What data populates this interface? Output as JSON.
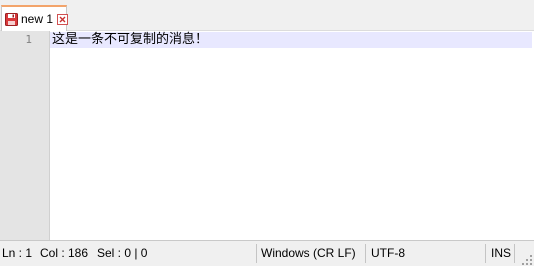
{
  "tabs": [
    {
      "label": "new 1",
      "icon": "save-icon",
      "close_icon": "close-icon",
      "accent": "#f3a46b"
    }
  ],
  "editor": {
    "line_numbers": [
      "1"
    ],
    "lines": [
      "这是一条不可复制的消息！"
    ],
    "current_line_color": "#e8e8ff",
    "gutter_color": "#e4e4e4"
  },
  "status_bar": {
    "ln": "Ln : 1",
    "col": "Col : 186",
    "sel": "Sel : 0 | 0",
    "eol": "Windows (CR LF)",
    "encoding": "UTF-8",
    "mode": "INS"
  }
}
